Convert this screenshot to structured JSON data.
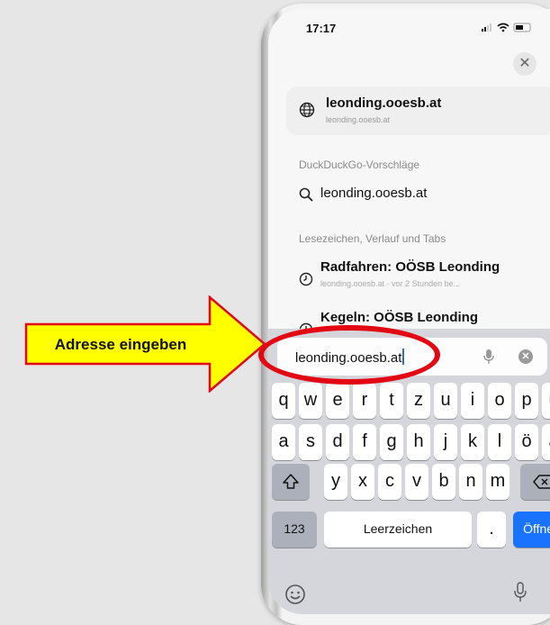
{
  "callout": {
    "label": "Adresse eingeben",
    "arrow_color": "#ffff00",
    "arrow_border": "#e30613",
    "highlight_color": "#e30613"
  },
  "status": {
    "time": "17:17",
    "icons": "signal-icon wifi-icon battery-icon"
  },
  "top_result": {
    "title": "leonding.ooesb.at",
    "subtitle": "leonding.ooesb.at",
    "icon": "globe-icon"
  },
  "sections": {
    "suggestions_header": "DuckDuckGo-Vorschläge",
    "history_header": "Lesezeichen, Verlauf und Tabs"
  },
  "suggestion": {
    "text": "leonding.ooesb.at",
    "icon": "search-icon"
  },
  "history": [
    {
      "title": "Radfahren: OÖSB Leonding",
      "subtitle": "leonding.ooesb.at · vor 2 Stunden be..."
    },
    {
      "title": "Kegeln: OÖSB Leonding",
      "subtitle": ""
    }
  ],
  "address_bar": {
    "value": "leonding.ooesb.at"
  },
  "keyboard": {
    "row1": [
      "q",
      "w",
      "e",
      "r",
      "t",
      "z",
      "u",
      "i",
      "o",
      "p",
      "ü"
    ],
    "row2": [
      "a",
      "s",
      "d",
      "f",
      "g",
      "h",
      "j",
      "k",
      "l",
      "ö",
      "ä"
    ],
    "row3": [
      "y",
      "x",
      "c",
      "v",
      "b",
      "n",
      "m"
    ],
    "numbers_key": "123",
    "space_key": "Leerzeichen",
    "period_key": ".",
    "go_key": "Öffnen",
    "accent": "#1a73ff"
  }
}
